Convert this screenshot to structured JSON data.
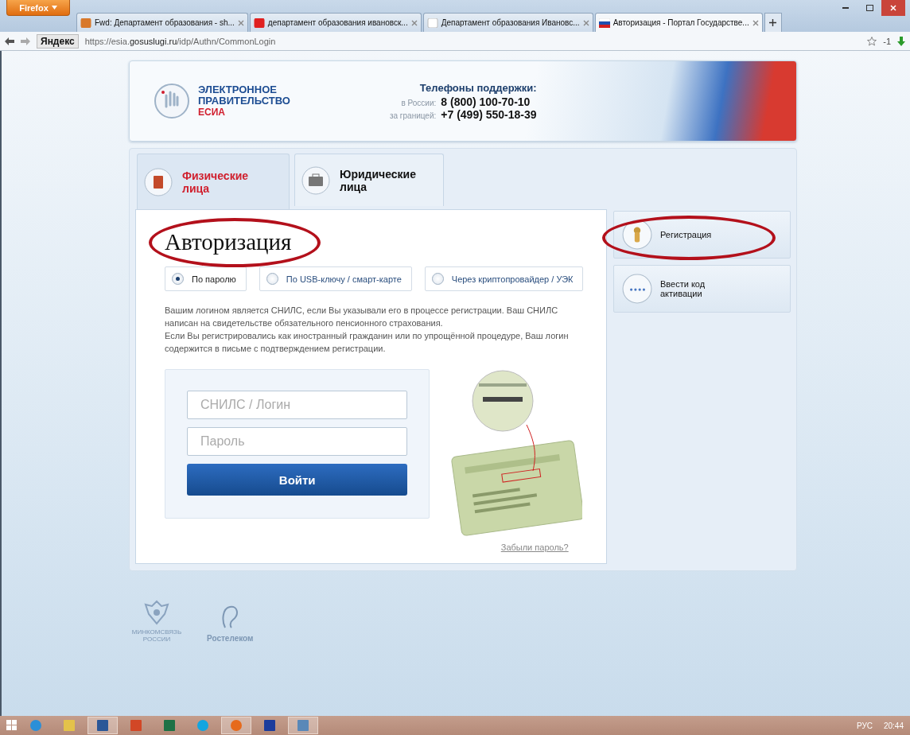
{
  "browser": {
    "menu_button": "Firefox",
    "tabs": [
      {
        "label": "Fwd: Департамент образования - sh...",
        "kind": "mail",
        "selected": false
      },
      {
        "label": "департамент образования ивановск...",
        "kind": "yandex",
        "selected": false
      },
      {
        "label": "Департамент образования Ивановс...",
        "kind": "blank",
        "selected": false
      },
      {
        "label": "Авторизация - Портал Государстве...",
        "kind": "flag",
        "selected": true
      }
    ],
    "search_engine": "Яндекс",
    "url": {
      "prefix": "https://esia.",
      "host": "gosuslugi.ru",
      "path": "/idp/Authn/CommonLogin"
    },
    "sync_count": "-1"
  },
  "header": {
    "logo_lines": [
      "ЭЛЕКТРОННОЕ",
      "ПРАВИТЕЛЬСТВО"
    ],
    "logo_sub": "ЕСИА",
    "support_title": "Телефоны поддержки:",
    "phones": [
      {
        "label": "в России:",
        "number": "8 (800) 100-70-10"
      },
      {
        "label": "за границей:",
        "number": "+7 (499) 550-18-39"
      }
    ]
  },
  "user_tabs": [
    {
      "label": "Физические лица",
      "kind": "person",
      "selected": true
    },
    {
      "label": "Юридические лица",
      "kind": "company",
      "selected": false
    }
  ],
  "login": {
    "title": "Авторизация",
    "title_circled": true,
    "methods": [
      {
        "label": "По паролю",
        "selected": true
      },
      {
        "label": "По USB-ключу / смарт-карте",
        "selected": false
      },
      {
        "label": "Через криптопровайдер / УЭК",
        "selected": false
      }
    ],
    "hint": [
      "Вашим логином является СНИЛС, если Вы указывали его в процессе регистрации. Ваш СНИЛС написан на свидетельстве обязательного пенсионного страхования.",
      "Если Вы регистрировались как иностранный гражданин или по упрощённой процедуре, Ваш логин содержится в письме с подтверждением регистрации."
    ],
    "fields": [
      {
        "placeholder": "СНИЛС / Логин"
      },
      {
        "placeholder": "Пароль"
      }
    ],
    "submit": "Войти",
    "forgot": "Забыли пароль?"
  },
  "side_actions": [
    {
      "label": "Регистрация",
      "kind": "keys",
      "circled": true
    },
    {
      "label": "Ввести код активации",
      "kind": "code",
      "circled": false
    }
  ],
  "footer": {
    "partners": [
      {
        "name": "МИНКОМСВЯЗЬ РОССИИ",
        "kind": "emblem"
      },
      {
        "name": "Ростелеком",
        "kind": "ear"
      }
    ]
  },
  "taskbar": {
    "apps": [
      {
        "kind": "browser-e",
        "selected": false
      },
      {
        "kind": "folder",
        "selected": false
      },
      {
        "kind": "word",
        "selected": true
      },
      {
        "kind": "slides",
        "selected": false
      },
      {
        "kind": "sheet",
        "selected": false
      },
      {
        "kind": "chat",
        "selected": false
      },
      {
        "kind": "fox",
        "selected": true
      },
      {
        "kind": "disk",
        "selected": false
      },
      {
        "kind": "image",
        "selected": true
      }
    ],
    "language": "РУС",
    "time": "20:44"
  }
}
